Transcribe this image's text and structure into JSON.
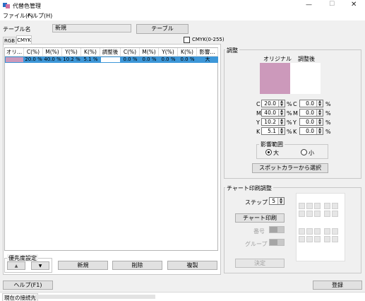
{
  "window": {
    "title": "代替色管理",
    "minimize": "—",
    "maximize": "☐",
    "close": "✕"
  },
  "menu": {
    "file": "ファイル(F)",
    "help": "ヘルプ(H)"
  },
  "table_name": {
    "label": "テーブル名",
    "value": "新規",
    "button": "テーブル"
  },
  "tabs": {
    "rgb": "RGB",
    "cmyk": "CMYK"
  },
  "cmyk_255_checkbox": {
    "label": "CMYK(0-255)",
    "checked": false
  },
  "table": {
    "headers": [
      "オリ...",
      "C(%)",
      "M(%)",
      "Y(%)",
      "K(%)",
      "調整後",
      "C(%)",
      "M(%)",
      "Y(%)",
      "K(%)",
      "影響..."
    ],
    "row": {
      "original_color": "#cc99bb",
      "values": [
        "20.0 %",
        "40.0 %",
        "10.2 %",
        "5.1 %",
        "",
        "0.0 %",
        "0.0 %",
        "0.0 %",
        "0.0 %",
        "大"
      ],
      "adjusted_color": "#ffffff"
    }
  },
  "priority": {
    "label": "優先度設定",
    "up": "▲",
    "down": "▼"
  },
  "actions": {
    "new": "新規",
    "delete": "削除",
    "copy": "複製"
  },
  "adjust": {
    "label": "調整",
    "original_label": "オリジナル",
    "adjusted_label": "調整後",
    "original_color": "#cc99bb",
    "adjusted_color": "#ffffff",
    "fields": [
      {
        "ch": "C",
        "orig": "20.0",
        "adj": "0.0"
      },
      {
        "ch": "M",
        "orig": "40.0",
        "adj": "0.0"
      },
      {
        "ch": "Y",
        "orig": "10.2",
        "adj": "0.0"
      },
      {
        "ch": "K",
        "orig": "5.1",
        "adj": "0.0"
      }
    ],
    "percent": "%",
    "range": {
      "label": "影響範囲",
      "large": "大",
      "small": "小",
      "selected": "大"
    },
    "spot_button": "スポットカラーから選択"
  },
  "chart": {
    "label": "チャート印刷調整",
    "step_label": "ステップ",
    "step_value": "5",
    "print_button": "チャート印刷",
    "number_label": "番号",
    "group_label": "グループ",
    "decide_button": "決定"
  },
  "footer": {
    "help": "ヘルプ(F1)",
    "register": "登録"
  },
  "status": {
    "label": "現在の接続先"
  }
}
